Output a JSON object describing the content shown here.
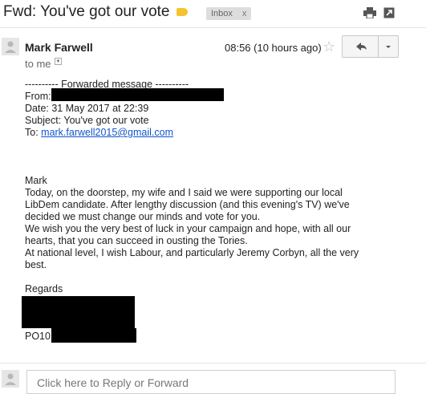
{
  "header": {
    "subject": "Fwd: You've got our vote",
    "label_color": "#f4c430",
    "inbox_chip": "Inbox",
    "inbox_chip_close": "x",
    "icons": [
      "print-icon",
      "new-window-icon"
    ]
  },
  "message": {
    "sender_name": "Mark Farwell",
    "timestamp": "08:56 (10 hours ago)",
    "star_icon": "☆",
    "recipient_line": "to me",
    "reply_icon": "reply-icon",
    "more_icon": "chevron-down-icon",
    "forwarded": {
      "header_line": "---------- Forwarded message ----------",
      "from_label": "From:",
      "date_line": "Date: 31 May 2017 at 22:39",
      "subject_line": "Subject: You've got our vote",
      "to_label": "To: ",
      "to_address": "mark.farwell2015@gmail.com"
    },
    "body_lines": [
      "Mark",
      "Today, on the doorstep, my wife and I said we were supporting our local",
      "LibDem candidate. After lengthy discussion (and this evening's TV) we've",
      "decided we must change our minds and vote for you.",
      "We wish you the very best of luck in your campaign and hope, with all our",
      "hearts, that you can succeed in ousting the Tories.",
      "At national level, I wish Labour, and particularly Jeremy Corbyn, all the very",
      "best."
    ],
    "sign_off": "Regards",
    "postcode_prefix": "PO10"
  },
  "reply_bar": {
    "placeholder": "Click here to Reply or Forward"
  }
}
